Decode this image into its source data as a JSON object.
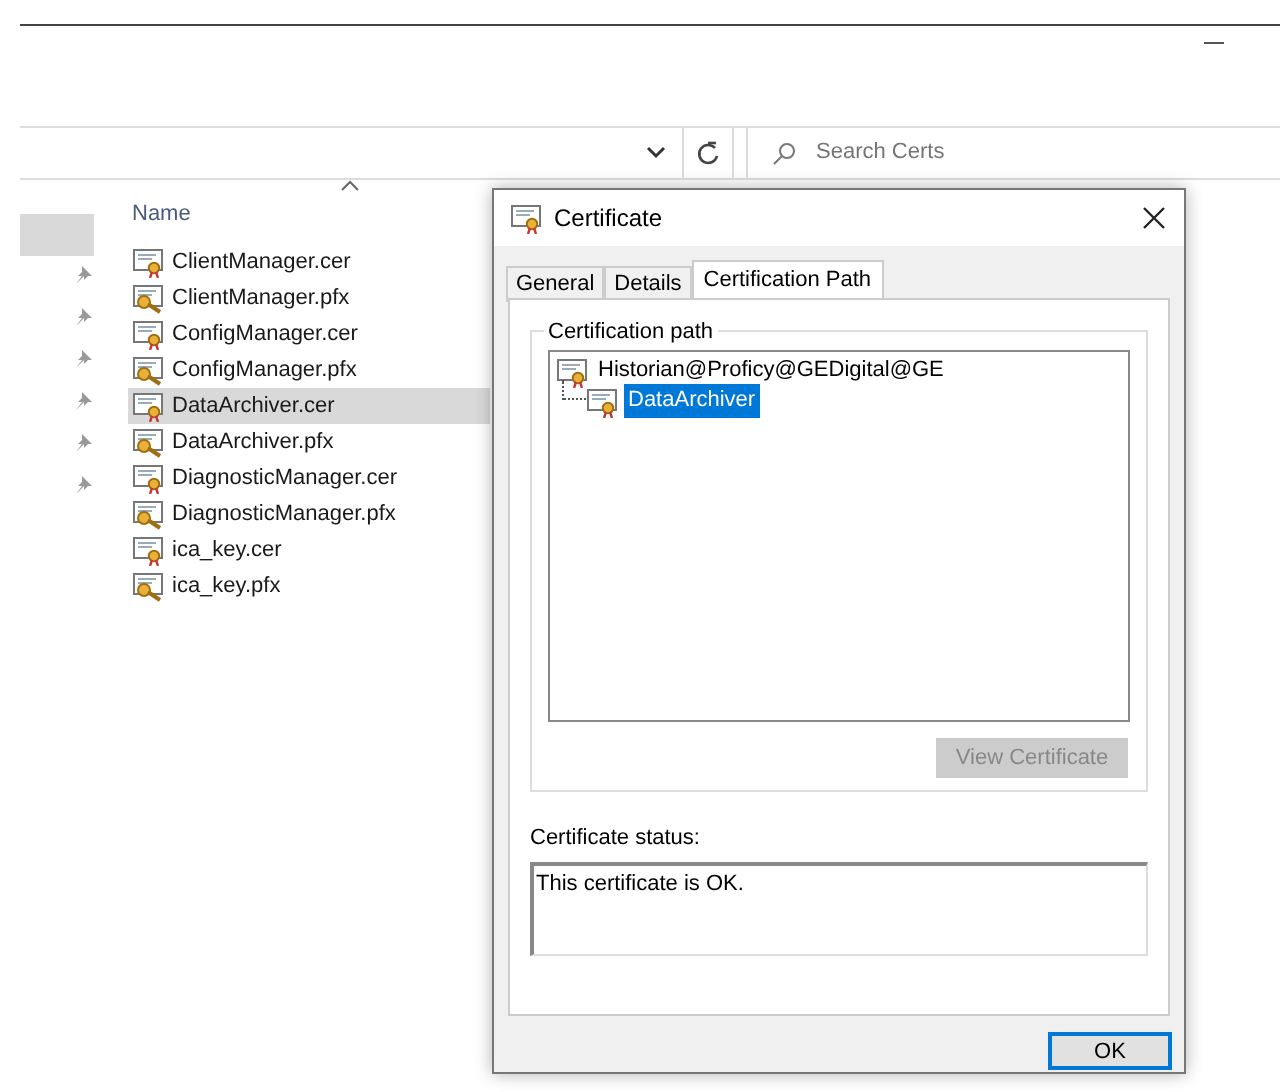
{
  "explorer": {
    "search": {
      "placeholder": "Search Certs"
    },
    "column": {
      "label": "Name"
    },
    "quick_access": [
      {
        "selected": true,
        "pinned": false
      },
      {
        "selected": false,
        "pinned": true
      },
      {
        "selected": false,
        "pinned": true
      },
      {
        "selected": false,
        "pinned": true
      },
      {
        "selected": false,
        "pinned": true
      },
      {
        "selected": false,
        "pinned": true
      },
      {
        "selected": false,
        "pinned": true
      }
    ],
    "files": [
      {
        "name": "ClientManager.cer",
        "kind": "certificate",
        "selected": false
      },
      {
        "name": "ClientManager.pfx",
        "kind": "keyfile",
        "selected": false
      },
      {
        "name": "ConfigManager.cer",
        "kind": "certificate",
        "selected": false
      },
      {
        "name": "ConfigManager.pfx",
        "kind": "keyfile",
        "selected": false
      },
      {
        "name": "DataArchiver.cer",
        "kind": "certificate",
        "selected": true
      },
      {
        "name": "DataArchiver.pfx",
        "kind": "keyfile",
        "selected": false
      },
      {
        "name": "DiagnosticManager.cer",
        "kind": "certificate",
        "selected": false
      },
      {
        "name": "DiagnosticManager.pfx",
        "kind": "keyfile",
        "selected": false
      },
      {
        "name": "ica_key.cer",
        "kind": "certificate",
        "selected": false
      },
      {
        "name": "ica_key.pfx",
        "kind": "keyfile",
        "selected": false
      }
    ]
  },
  "dialog": {
    "title": "Certificate",
    "tabs": [
      {
        "label": "General",
        "selected": false
      },
      {
        "label": "Details",
        "selected": false
      },
      {
        "label": "Certification Path",
        "selected": true
      }
    ],
    "group_label": "Certification path",
    "tree": [
      {
        "label": "Historian@Proficy@GEDigital@GE",
        "selected": false,
        "children": [
          {
            "label": "DataArchiver",
            "selected": true
          }
        ]
      }
    ],
    "view_button": {
      "label": "View Certificate",
      "disabled": true
    },
    "status_label": "Certificate status:",
    "status_text": "This certificate is OK.",
    "ok_button": {
      "label": "OK",
      "focused": true
    }
  }
}
